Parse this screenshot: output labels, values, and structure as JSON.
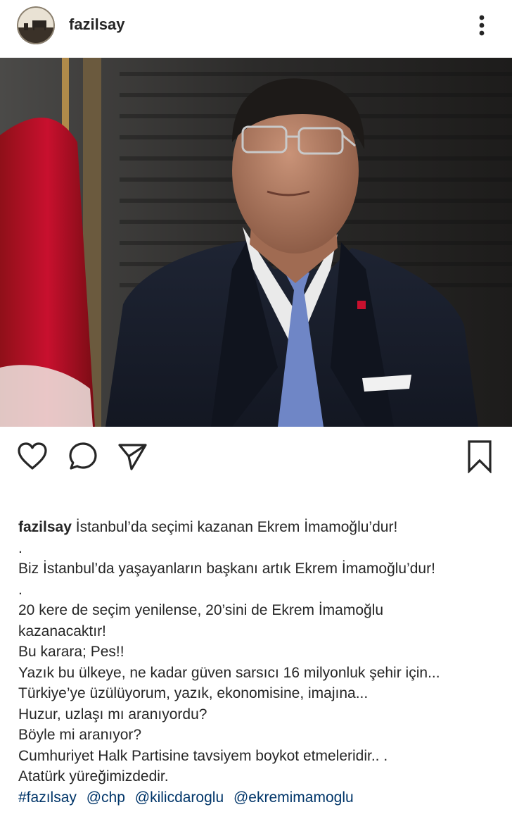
{
  "post": {
    "username": "fazilsay",
    "avatar_icon": "profile-avatar",
    "more_icon": "more-options-icon"
  },
  "actions": {
    "like_icon": "heart-icon",
    "comment_icon": "comment-icon",
    "share_icon": "paper-plane-icon",
    "save_icon": "bookmark-icon"
  },
  "caption": {
    "author": "fazilsay",
    "lines": [
      "İstanbul’da seçimi kazanan Ekrem İmamoğlu’dur!",
      ".",
      "Biz İstanbul’da yaşayanların başkanı artık Ekrem İmamoğlu’dur!",
      ".",
      "20 kere de seçim yenilense, 20’sini de Ekrem İmamoğlu",
      "kazanacaktır!",
      "Bu karara; Pes!!",
      "Yazık bu ülkeye, ne kadar güven sarsıcı 16 milyonluk şehir için...",
      "Türkiye’ye üzülüyorum, yazık, ekonomisine, imajına...",
      "Huzur, uzlaşı mı aranıyordu?",
      "Böyle mi aranıyor?",
      "Cumhuriyet Halk Partisine tavsiyem boykot etmeleridir.. .",
      "Atatürk yüreğimizdedir."
    ],
    "tags": [
      "#fazılsay",
      "@chp",
      "@kilicdaroglu",
      "@ekremimamoglu"
    ]
  },
  "colors": {
    "text": "#262626",
    "link": "#003569",
    "flag_red": "#c8102e"
  }
}
